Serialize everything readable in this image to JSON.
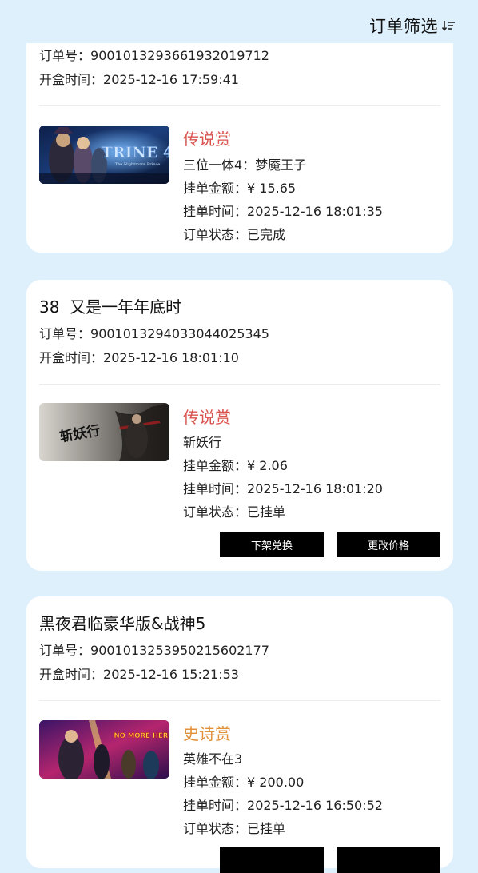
{
  "header": {
    "filter_label": "订单筛选"
  },
  "colors": {
    "background": "#dff0fd",
    "legendary": "#d9534f",
    "epic": "#e0913a"
  },
  "labels": {
    "order_no": "订单号：",
    "open_time": "开盒时间：",
    "amount": "挂单金额：",
    "list_time": "挂单时间：",
    "status": "订单状态："
  },
  "orders": [
    {
      "order_no": "9001013293661932019712",
      "open_time": "2025-12-16 17:59:41",
      "item": {
        "image": "trine-4-cover",
        "image_text": "TRINE 4",
        "image_subtext": "The Nightmare Prince",
        "rarity": "传说赏",
        "name": "三位一体4：梦魇王子",
        "amount": "¥ 15.65",
        "list_time": "2025-12-16 18:01:35",
        "status": "已完成"
      }
    },
    {
      "title": "38  又是一年年底时",
      "order_no": "9001013294033044025345",
      "open_time": "2025-12-16 18:01:10",
      "item": {
        "image": "zhanyaoxing-cover",
        "image_text": "斩妖行",
        "rarity": "传说赏",
        "name": "斩妖行",
        "amount": "¥ 2.06",
        "list_time": "2025-12-16 18:01:20",
        "status": "已挂单"
      },
      "actions": {
        "delist": "下架兑换",
        "change_price": "更改价格"
      }
    },
    {
      "title": "黑夜君临豪华版&战神5",
      "order_no": "9001013253950215602177",
      "open_time": "2025-12-16 15:21:53",
      "item": {
        "image": "no-more-heroes-3-cover",
        "image_text": "NO MORE HEROES",
        "rarity": "史诗赏",
        "name": "英雄不在3",
        "amount": "¥ 200.00",
        "list_time": "2025-12-16 16:50:52",
        "status": "已挂单"
      }
    }
  ]
}
